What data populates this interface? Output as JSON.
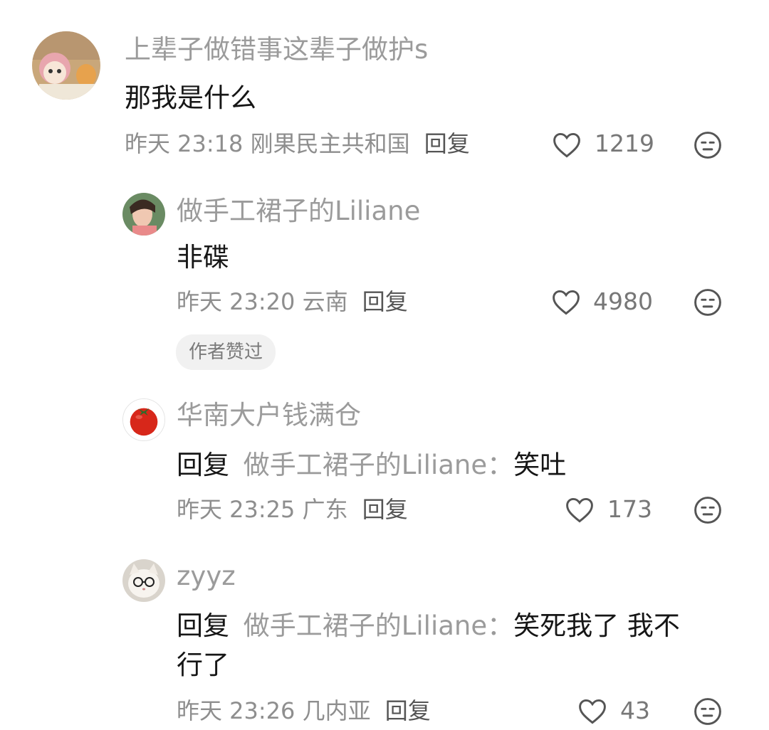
{
  "comments": [
    {
      "username": "上辈子做错事这辈子做护s",
      "text": "那我是什么",
      "time": "昨天 23:18",
      "location": "刚果民主共和国",
      "reply_label": "回复",
      "likes": "1219"
    },
    {
      "username": "做手工裙子的Liliane",
      "text": "非碟",
      "time": "昨天 23:20",
      "location": "云南",
      "reply_label": "回复",
      "likes": "4980",
      "badge": "作者赞过"
    },
    {
      "username": "华南大户钱满仓",
      "reply_prefix": "回复",
      "reply_target": "做手工裙子的Liliane：",
      "text": "笑吐",
      "time": "昨天 23:25",
      "location": "广东",
      "reply_label": "回复",
      "likes": "173"
    },
    {
      "username": "zyyz",
      "reply_prefix": "回复",
      "reply_target": "做手工裙子的Liliane：",
      "text_line1": "笑死我了 我不",
      "text_line2": "行了",
      "time": "昨天 23:26",
      "location": "几内亚",
      "reply_label": "回复",
      "likes": "43"
    }
  ],
  "icons": {
    "like": "heart-outline-icon",
    "emoji": "sweat-face-icon"
  },
  "colors": {
    "username": "#9b9b9b",
    "text": "#161616",
    "meta": "#8e8e8e",
    "badge_bg": "#f1f1f1"
  }
}
